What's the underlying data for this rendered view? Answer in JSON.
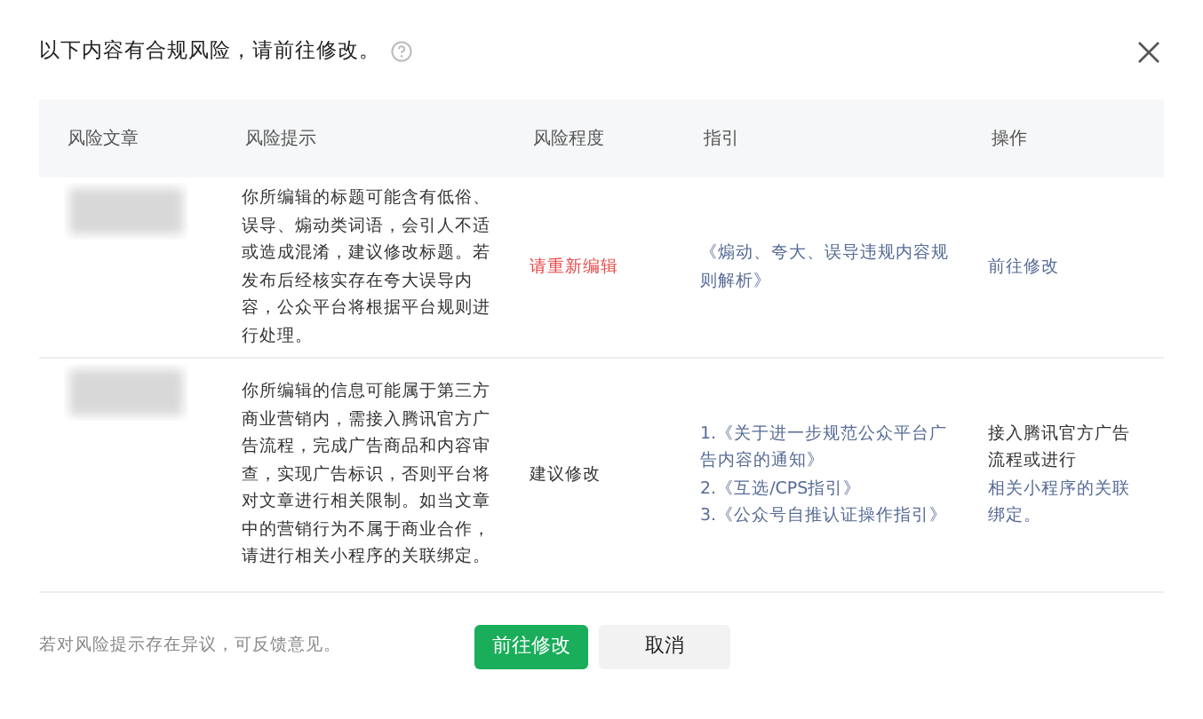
{
  "dialog": {
    "title": "以下内容有合规风险，请前往修改。"
  },
  "table": {
    "columns": [
      "风险文章",
      "风险提示",
      "风险程度",
      "指引",
      "操作"
    ],
    "rows": [
      {
        "hint": "你所编辑的标题可能含有低俗、误导、煽动类词语，会引人不适或造成混淆，建议修改标题。若发布后经核实存在夸大误导内容，公众平台将根据平台规则进行处理。",
        "level": {
          "text": "请重新编辑",
          "kind": "danger"
        },
        "guides": [
          "《煽动、夸大、误导违规内容规则解析》"
        ],
        "action": {
          "kind": "link",
          "link": "前往修改"
        }
      },
      {
        "hint": "你所编辑的信息可能属于第三方商业营销内，需接入腾讯官方广告流程，完成广告商品和内容审查，实现广告标识，否则平台将对文章进行相关限制。如当文章中的营销行为不属于商业合作，请进行相关小程序的关联绑定。",
        "level": {
          "text": "建议修改",
          "kind": "normal"
        },
        "guides": [
          "1.《关于进一步规范公众平台广告内容的通知》",
          "2.《互选/CPS指引》",
          "3.《公众号自推认证操作指引》"
        ],
        "action": {
          "kind": "mixed",
          "text": "接入腾讯官方广告流程或进行",
          "link": "相关小程序的关联绑定。"
        }
      }
    ]
  },
  "footer": {
    "note": "若对风险提示存在异议，可反馈意见。",
    "buttons": [
      {
        "label": "前往修改",
        "kind": "primary"
      },
      {
        "label": "取消",
        "kind": "secondary"
      }
    ]
  }
}
